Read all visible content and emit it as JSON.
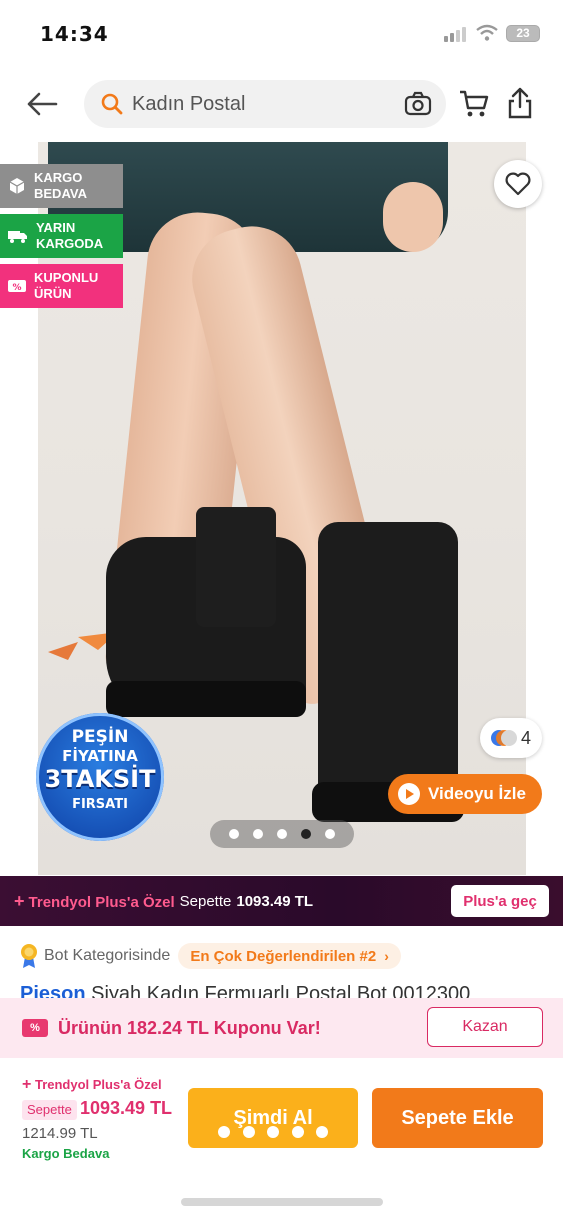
{
  "status": {
    "time": "14:34",
    "battery": "23"
  },
  "search": {
    "query": "Kadın Postal"
  },
  "badges": [
    {
      "label": "KARGO BEDAVA"
    },
    {
      "label": "YARIN KARGODA"
    },
    {
      "label": "KUPONLU ÜRÜN"
    }
  ],
  "promo_badge": {
    "line1": "PEŞİN",
    "line2": "FİYATINA",
    "line3": "3TAKSİT",
    "line4": "FIRSATI"
  },
  "media": {
    "photo_count": "4",
    "video_label": "Videoyu İzle",
    "pages_total": 5,
    "page_active": 4
  },
  "plus_strip": {
    "label": "Trendyol Plus'a Özel",
    "cart_text": "Sepette",
    "price": "1093.49 TL",
    "button": "Plus'a geç"
  },
  "rating": {
    "label": "Bot Kategorisinde",
    "chip": "En Çok Değerlendirilen #2"
  },
  "product": {
    "brand": "Pieson",
    "title": "Siyah Kadın Fermuarlı Postal Bot 0012300"
  },
  "coupon": {
    "text": "Ürünün 182.24 TL Kuponu Var!",
    "button": "Kazan"
  },
  "footer": {
    "plus_label": "Trendyol Plus'a Özel",
    "cart_tag": "Sepette",
    "price": "1093.49 TL",
    "old_price": "1214.99 TL",
    "shipping": "Kargo Bedava",
    "buy_now": "Şimdi Al",
    "add_to_cart": "Sepete Ekle"
  },
  "colors": {
    "brand_orange": "#f27a1a",
    "buy_yellow": "#fbb01b",
    "plus_pink": "#e0306e",
    "green": "#1ba446"
  }
}
